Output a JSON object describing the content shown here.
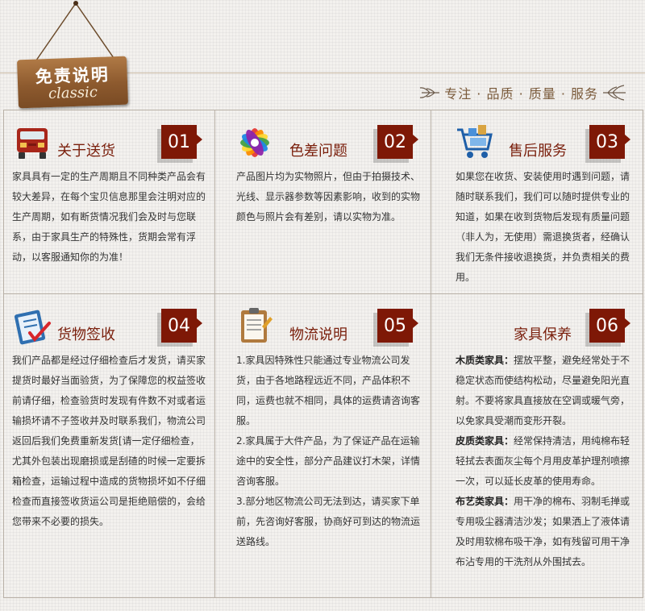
{
  "header": {
    "sign_title": "免责说明",
    "sign_subtitle": "classic",
    "service_text": "专注 · 品质 · 质量 · 服务"
  },
  "cards": [
    {
      "icon": "delivery-truck-icon",
      "title": "关于送货",
      "number": "01",
      "text": "家具具有一定的生产周期且不同种类产品会有较大差异，在每个宝贝信息那里会注明对应的生产周期，如有断货情况我们会及时与您联系，由于家具生产的特殊性，货期会常有浮动，以客服通知你的为准！"
    },
    {
      "icon": "color-palette-icon",
      "title": "色差问题",
      "number": "02",
      "text": "产品图片均为实物照片，但由于拍摄技术、光线、显示器参数等因素影响，收到的实物颜色与照片会有差别，请以实物为准。"
    },
    {
      "icon": "shopping-cart-icon",
      "title": "售后服务",
      "number": "03",
      "text": "如果您在收货、安装使用时遇到问题，请随时联系我们，我们可以随时提供专业的知道，如果在收到货物后发现有质量问题（非人为，无使用）需退换货者，经确认我们无条件接收退换货，并负责相关的费用。"
    },
    {
      "icon": "checklist-icon",
      "title": "货物签收",
      "number": "04",
      "text": "我们产品都是经过仔细检查后才发货，请买家提货时最好当面验货，为了保障您的权益签收前请仔细，检查验货时发现有件数不对或者运输损坏请不子签收并及时联系我们，物流公司返回后我们免费重新发货[请一定仔细检查，尤其外包装出现磨损或是刮碴的时候一定要拆箱检查，运输过程中造成的货物损坏如不仔细检查而直接签收货运公司是拒绝赔偿的，会给您带来不必要的损失。"
    },
    {
      "icon": "clipboard-icon",
      "title": "物流说明",
      "number": "05",
      "paragraphs": [
        "1.家具因特殊性只能通过专业物流公司发货，由于各地路程远近不同，产品体积不同，运费也就不相同，具体的运费请咨询客服。",
        "2.家具属于大件产品，为了保证产品在运输途中的安全性，部分产品建议打木架，详情咨询客服。",
        "3.部分地区物流公司无法到达，请买家下单前，先咨询好客服，协商好可到达的物流运送路线。"
      ]
    },
    {
      "icon": "",
      "title": "家具保养",
      "number": "06",
      "sections": [
        {
          "label": "木质类家具：",
          "text": "摆放平整，避免经常处于不稳定状态而使结构松动，尽量避免阳光直射。不要将家具直接放在空调或暖气旁，以免家具受潮而变形开裂。"
        },
        {
          "label": "皮质类家具：",
          "text": "经常保持清洁，用纯棉布轻轻拭去表面灰尘每个月用皮革护理剂喷擦一次，可以延长皮革的使用寿命。"
        },
        {
          "label": "布艺类家具：",
          "text": "用干净的棉布、羽制毛掸或专用吸尘器清洁沙发；如果洒上了液体请及时用软棉布吸干净，如有残留可用干净布沾专用的干洗剂从外围拭去。"
        }
      ]
    }
  ],
  "colors": {
    "accent": "#7e1806",
    "title": "#7a1f0c",
    "wood": "#8d5a2e"
  }
}
